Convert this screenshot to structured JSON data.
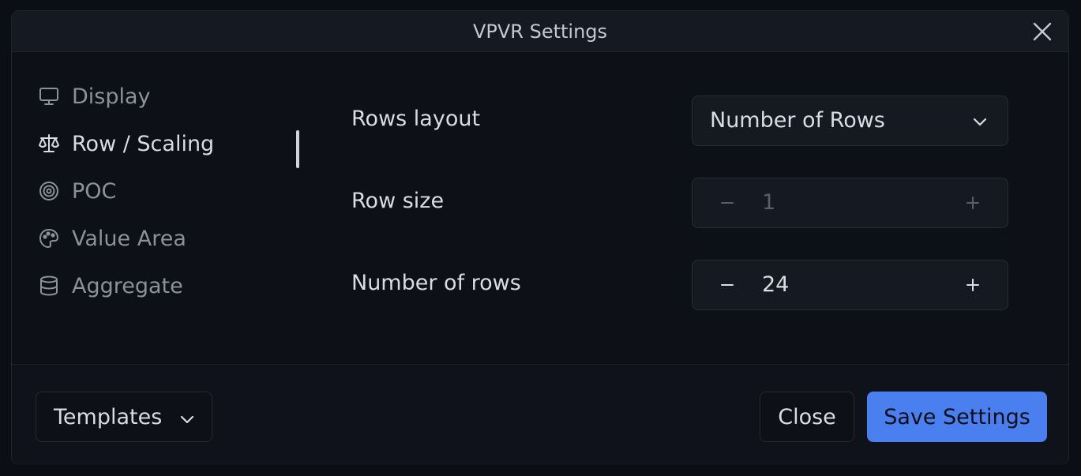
{
  "dialog": {
    "title": "VPVR Settings",
    "close_icon": "close-icon"
  },
  "nav": {
    "items": [
      {
        "label": "Display",
        "icon": "monitor-icon",
        "active": false
      },
      {
        "label": "Row / Scaling",
        "icon": "scale-icon",
        "active": true
      },
      {
        "label": "POC",
        "icon": "target-icon",
        "active": false
      },
      {
        "label": "Value Area",
        "icon": "palette-icon",
        "active": false
      },
      {
        "label": "Aggregate",
        "icon": "database-icon",
        "active": false
      }
    ]
  },
  "settings": {
    "rows_layout": {
      "label": "Rows layout",
      "value": "Number of Rows"
    },
    "row_size": {
      "label": "Row size",
      "value": "1",
      "disabled": true
    },
    "number_of_rows": {
      "label": "Number of rows",
      "value": "24",
      "disabled": false
    }
  },
  "footer": {
    "templates_label": "Templates",
    "close_label": "Close",
    "save_label": "Save Settings"
  },
  "colors": {
    "accent": "#4a7ff0",
    "background": "#0d1017",
    "text": "#d9dce3",
    "muted": "#8d919b"
  }
}
